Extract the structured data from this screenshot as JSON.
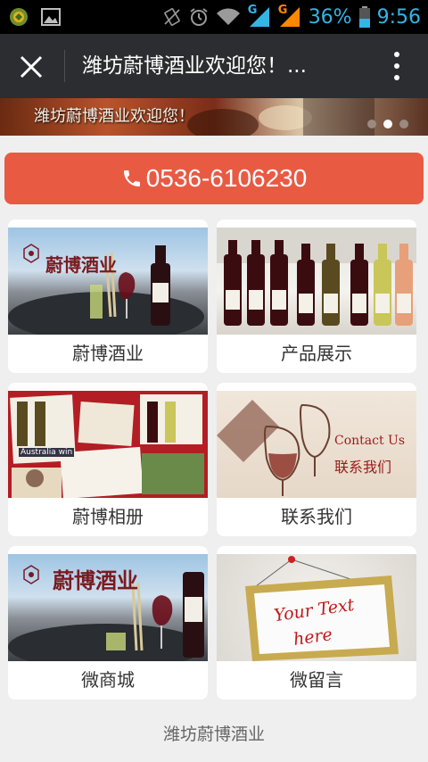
{
  "status_bar": {
    "battery_percent": "36%",
    "time": "9:56",
    "network_1": "G",
    "network_2": "G",
    "accent_color": "#33b5e5",
    "icons": [
      "app-notification-icon",
      "image-icon",
      "vibrate-icon",
      "alarm-icon",
      "wifi-icon",
      "signal-icon",
      "signal-icon",
      "battery-icon"
    ]
  },
  "title_bar": {
    "title": "潍坊蔚博酒业欢迎您！...",
    "close_icon": "close-icon",
    "menu_icon": "more-vert-icon"
  },
  "banner": {
    "caption": "潍坊蔚博酒业欢迎您！",
    "slide_count": 3,
    "active_slide": 2
  },
  "phone": {
    "icon": "phone-icon",
    "number": "0536-6106230",
    "color": "#e95a43"
  },
  "tiles": [
    {
      "label": "蔚博酒业",
      "image_text": "蔚博酒业"
    },
    {
      "label": "产品展示"
    },
    {
      "label": "蔚博相册",
      "image_text": "Australia win"
    },
    {
      "label": "联系我们",
      "image_text_en": "Contact Us",
      "image_text_cn": "联系我们"
    },
    {
      "label": "微商城",
      "image_text": "蔚博酒业"
    },
    {
      "label": "微留言",
      "image_text_1": "Your Text",
      "image_text_2": "here"
    }
  ],
  "footer": {
    "text": "潍坊蔚博酒业"
  }
}
